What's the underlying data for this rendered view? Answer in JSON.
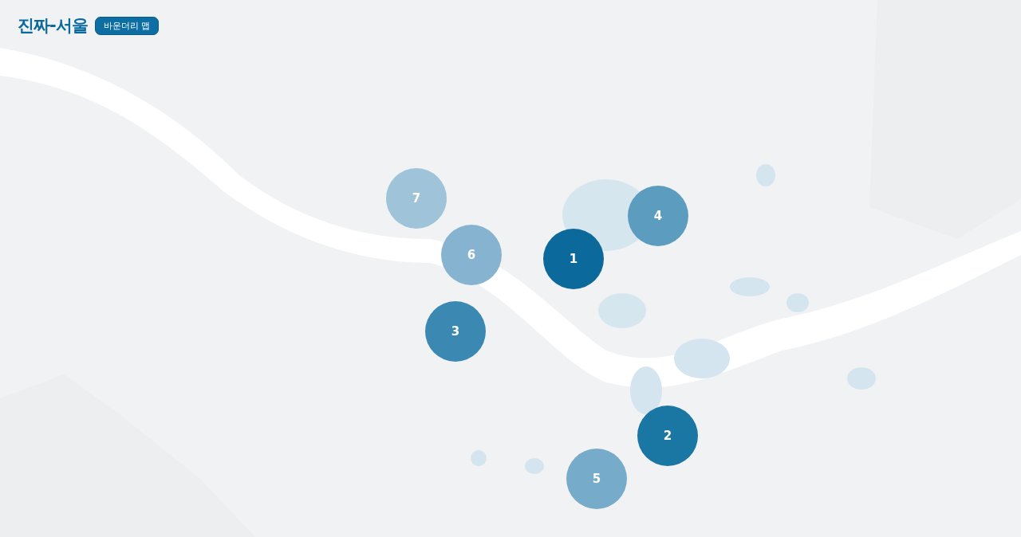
{
  "header": {
    "title": "진짜-서울",
    "badge": "바운더리 맵"
  },
  "clusters": [
    {
      "label": "1",
      "color": "#0b6a9b"
    },
    {
      "label": "2",
      "color": "#1a76a3"
    },
    {
      "label": "3",
      "color": "#3b89b2"
    },
    {
      "label": "4",
      "color": "#5c9cbf"
    },
    {
      "label": "5",
      "color": "#77abca"
    },
    {
      "label": "6",
      "color": "#86b4d0"
    },
    {
      "label": "7",
      "color": "#9fc3d8"
    }
  ]
}
